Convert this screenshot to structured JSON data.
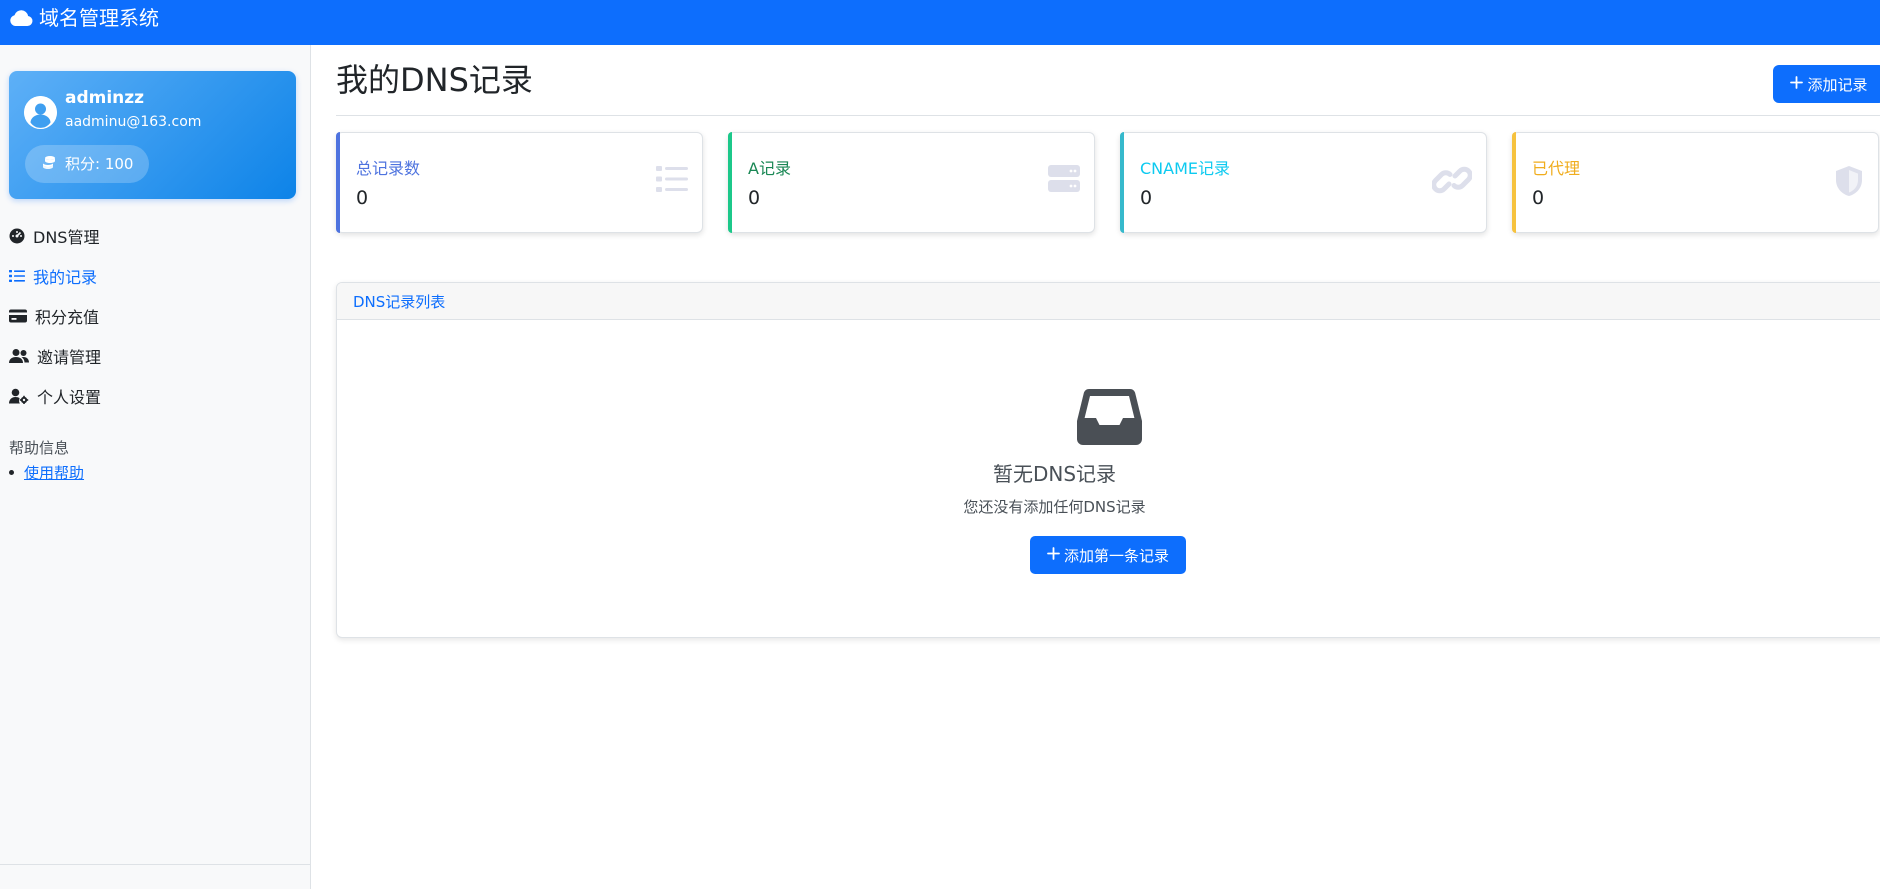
{
  "app": {
    "title": "域名管理系统",
    "brand_icon": "cloud-icon"
  },
  "user": {
    "name": "adminzz",
    "email": "aadminu@163.com",
    "points_label": "积分: 100",
    "avatar_icon": "user-circle-icon",
    "points_icon": "coins-icon"
  },
  "sidebar": {
    "items": [
      {
        "label": "DNS管理",
        "icon": "dashboard-icon",
        "active": false
      },
      {
        "label": "我的记录",
        "icon": "list-icon",
        "active": true
      },
      {
        "label": "积分充值",
        "icon": "credit-card-icon",
        "active": false
      },
      {
        "label": "邀请管理",
        "icon": "users-icon",
        "active": false
      },
      {
        "label": "个人设置",
        "icon": "user-gear-icon",
        "active": false
      }
    ],
    "help_title": "帮助信息",
    "help_links": [
      "使用帮助"
    ]
  },
  "page": {
    "title": "我的DNS记录",
    "add_button": "添加记录"
  },
  "stats": [
    {
      "label": "总记录数",
      "value": "0",
      "color": "#4e73df",
      "icon": "list-icon"
    },
    {
      "label": "A记录",
      "value": "0",
      "color": "#1cc88a",
      "icon": "server-icon"
    },
    {
      "label": "CNAME记录",
      "value": "0",
      "color": "#36b9cc",
      "icon": "link-icon"
    },
    {
      "label": "已代理",
      "value": "0",
      "color": "#f6c23e",
      "icon": "shield-icon"
    }
  ],
  "records_panel": {
    "title": "DNS记录列表",
    "empty_icon": "inbox-icon",
    "empty_title": "暂无DNS记录",
    "empty_subtitle": "您还没有添加任何DNS记录",
    "empty_button": "添加第一条记录"
  },
  "colors": {
    "primary": "#0d6efd",
    "sidebar_bg": "#f8f9fa"
  }
}
